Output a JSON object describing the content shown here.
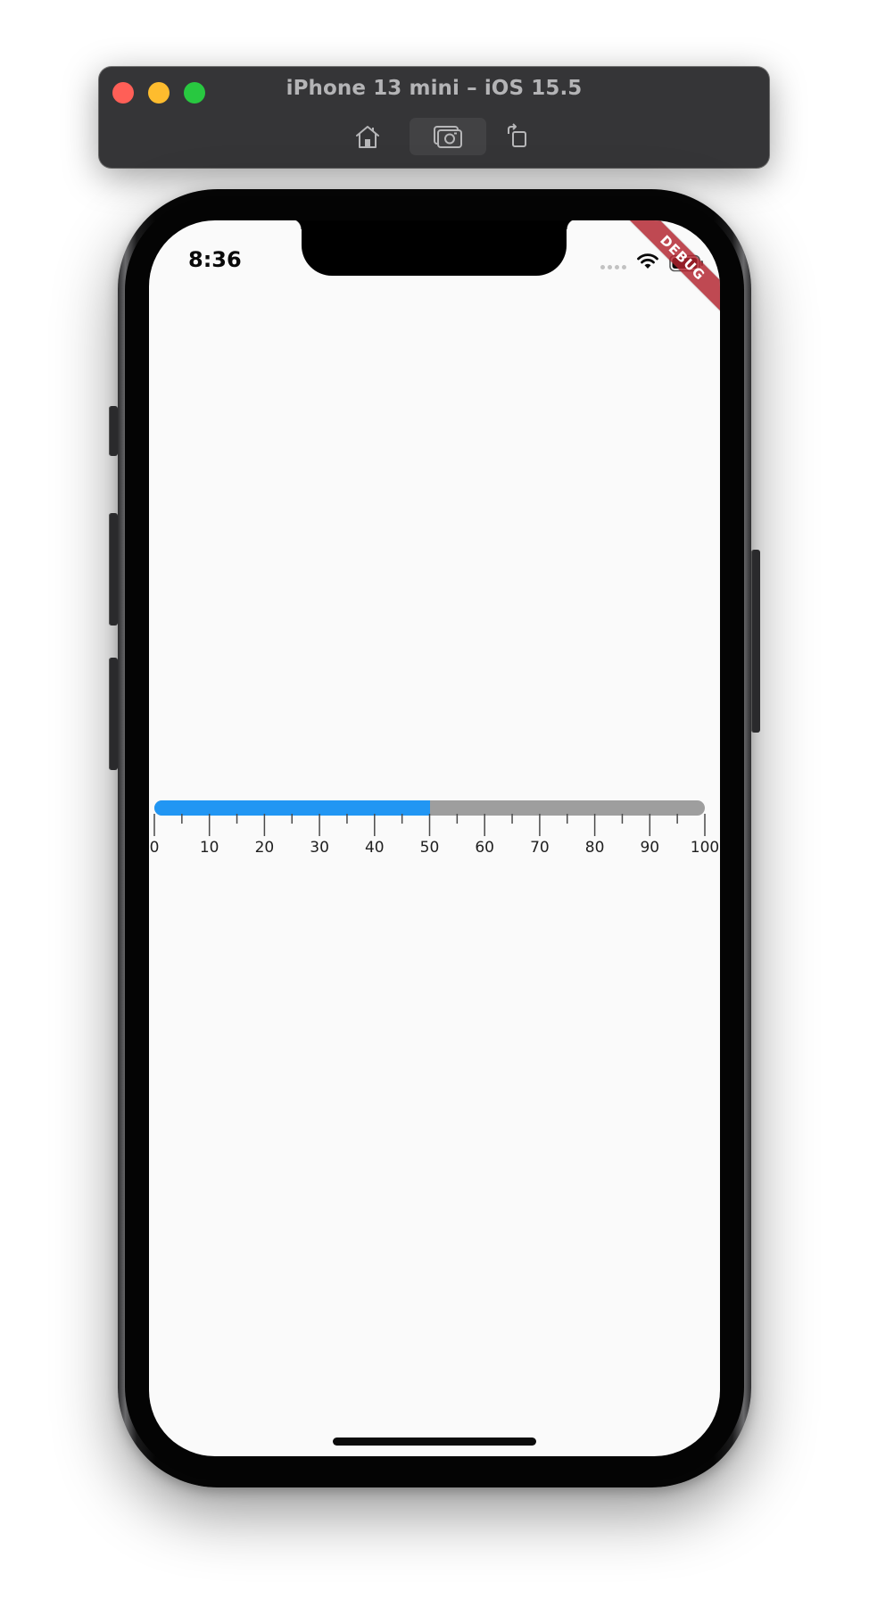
{
  "window": {
    "title": "iPhone 13 mini – iOS 15.5",
    "traffic_lights": {
      "close": "#ff5f57",
      "minimize": "#febc2e",
      "zoom": "#28c840"
    },
    "toolbar": {
      "home_icon": "home-icon",
      "screenshot_icon": "camera-icon",
      "rotate_icon": "rotate-icon"
    }
  },
  "status_bar": {
    "time": "8:36",
    "signal_icon": "signal-dots-icon",
    "wifi_icon": "wifi-icon",
    "battery_icon": "battery-icon"
  },
  "debug_banner": "DEBUG",
  "slider": {
    "min": 0,
    "max": 100,
    "value": 50,
    "active_color": "#2196f3",
    "inactive_color": "#9e9e9e",
    "minor_tick_step": 5,
    "labels": [
      "0",
      "10",
      "20",
      "30",
      "40",
      "50",
      "60",
      "70",
      "80",
      "90",
      "100"
    ]
  }
}
